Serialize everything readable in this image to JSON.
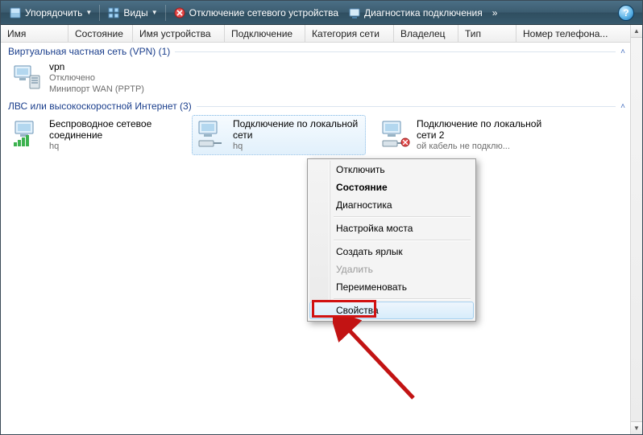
{
  "toolbar": {
    "organize": "Упорядочить",
    "views": "Виды",
    "disable_device": "Отключение сетевого устройства",
    "diagnose": "Диагностика подключения",
    "overflow": "»"
  },
  "columns": [
    "Имя",
    "Состояние",
    "Имя устройства",
    "Подключение",
    "Категория сети",
    "Владелец",
    "Тип",
    "Номер телефона..."
  ],
  "groups": {
    "vpn": {
      "label": "Виртуальная частная сеть (VPN) (1)",
      "items": [
        {
          "name": "vpn",
          "status": "Отключено",
          "device": "Минипорт WAN (PPTP)"
        }
      ]
    },
    "lan": {
      "label": "ЛВС или высокоскоростной Интернет (3)",
      "items": [
        {
          "name": "Беспроводное сетевое соединение",
          "status": "hq"
        },
        {
          "name": "Подключение по локальной сети",
          "status": "hq"
        },
        {
          "name": "Подключение по локальной сети 2",
          "status": "ой кабель не подклю..."
        }
      ]
    }
  },
  "context_menu": {
    "items": [
      {
        "label": "Отключить"
      },
      {
        "label": "Состояние",
        "bold": true
      },
      {
        "label": "Диагностика"
      },
      {
        "sep": true
      },
      {
        "label": "Настройка моста"
      },
      {
        "sep": true
      },
      {
        "label": "Создать ярлык"
      },
      {
        "label": "Удалить",
        "disabled": true
      },
      {
        "label": "Переименовать"
      },
      {
        "sep": true
      },
      {
        "label": "Свойства",
        "highlighted": true
      }
    ]
  }
}
